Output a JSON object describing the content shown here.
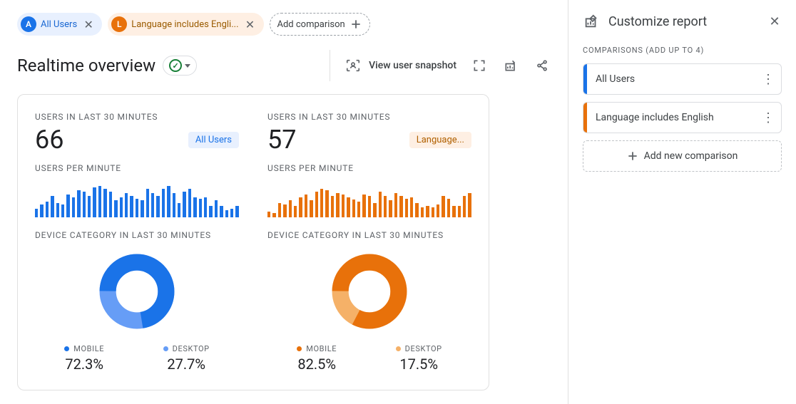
{
  "chips": {
    "all_users_badge": "A",
    "all_users_label": "All Users",
    "language_badge": "L",
    "language_label": "Language includes Engli...",
    "add_label": "Add comparison"
  },
  "header": {
    "title": "Realtime overview",
    "snapshot_label": "View user snapshot"
  },
  "cards": [
    {
      "users_label": "USERS IN LAST 30 MINUTES",
      "users_value": "66",
      "tag": "All Users",
      "tag_color": "blue",
      "upm_label": "USERS PER MINUTE",
      "device_label": "DEVICE CATEGORY IN LAST 30 MINUTES",
      "legend": [
        {
          "name": "MOBILE",
          "pct": "72.3%",
          "color": "#1a73e8"
        },
        {
          "name": "DESKTOP",
          "pct": "27.7%",
          "color": "#669df6"
        }
      ]
    },
    {
      "users_label": "USERS IN LAST 30 MINUTES",
      "users_value": "57",
      "tag": "Language...",
      "tag_color": "orange",
      "upm_label": "USERS PER MINUTE",
      "device_label": "DEVICE CATEGORY IN LAST 30 MINUTES",
      "legend": [
        {
          "name": "MOBILE",
          "pct": "82.5%",
          "color": "#e8710a"
        },
        {
          "name": "DESKTOP",
          "pct": "17.5%",
          "color": "#f5b168"
        }
      ]
    }
  ],
  "side": {
    "title": "Customize report",
    "sub": "COMPARISONS (ADD UP TO 4)",
    "items": [
      {
        "label": "All Users",
        "stripe": "blue"
      },
      {
        "label": "Language includes English",
        "stripe": "orange"
      }
    ],
    "add_label": "Add new comparison"
  },
  "chart_data": [
    {
      "type": "bar",
      "title": "Users per minute — All Users",
      "ylim": [
        0,
        50
      ],
      "values": [
        12,
        18,
        22,
        30,
        20,
        18,
        32,
        28,
        38,
        36,
        30,
        42,
        44,
        40,
        36,
        24,
        28,
        34,
        30,
        26,
        24,
        40,
        34,
        30,
        40,
        44,
        34,
        20,
        36,
        40,
        28,
        26,
        28,
        16,
        24,
        16,
        10,
        12,
        16
      ]
    },
    {
      "type": "bar",
      "title": "Users per minute — Language includes English",
      "ylim": [
        0,
        50
      ],
      "values": [
        8,
        6,
        20,
        18,
        24,
        16,
        28,
        32,
        24,
        36,
        40,
        38,
        30,
        34,
        32,
        28,
        25,
        22,
        32,
        30,
        20,
        36,
        30,
        24,
        34,
        30,
        26,
        28,
        20,
        14,
        16,
        14,
        18,
        30,
        26,
        16,
        16,
        30,
        34
      ]
    },
    {
      "type": "pie",
      "title": "Device category — All Users",
      "series": [
        {
          "name": "MOBILE",
          "value": 72.3
        },
        {
          "name": "DESKTOP",
          "value": 27.7
        }
      ]
    },
    {
      "type": "pie",
      "title": "Device category — Language includes English",
      "series": [
        {
          "name": "MOBILE",
          "value": 82.5
        },
        {
          "name": "DESKTOP",
          "value": 17.5
        }
      ]
    }
  ]
}
